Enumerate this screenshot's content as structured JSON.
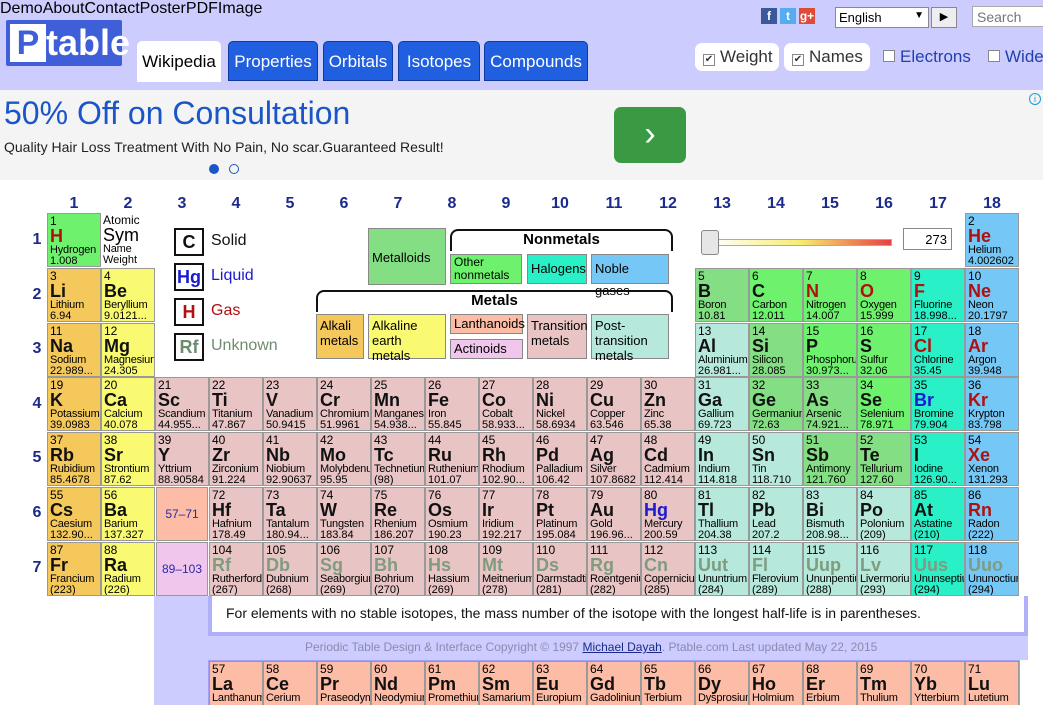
{
  "logo": {
    "text": "Ptable"
  },
  "toplinks": [
    "Demo",
    "About",
    "Contact",
    "Poster",
    "PDF",
    "Image"
  ],
  "social": [
    {
      "icon": "facebook-icon",
      "glyph": "f",
      "color": "#3b5998"
    },
    {
      "icon": "twitter-icon",
      "glyph": "t",
      "color": "#55acee"
    },
    {
      "icon": "google-plus-icon",
      "glyph": "g+",
      "color": "#dd4b39"
    }
  ],
  "language": {
    "selected": "English",
    "go": "▶"
  },
  "search": {
    "placeholder": "Search"
  },
  "tabs": [
    "Wikipedia",
    "Properties",
    "Orbitals",
    "Isotopes",
    "Compounds"
  ],
  "options": [
    {
      "label": "Weight",
      "checked": true
    },
    {
      "label": "Names",
      "checked": true
    },
    {
      "label": "Electrons",
      "checked": false
    },
    {
      "label": "Wide",
      "checked": false
    }
  ],
  "ad": {
    "title": "50% Off on Consultation",
    "subtitle": "Quality Hair Loss Treatment With No Pain, No scar.Guaranteed Result!",
    "button": "›",
    "info": "i"
  },
  "groups": [
    "1",
    "2",
    "3",
    "4",
    "5",
    "6",
    "7",
    "8",
    "9",
    "10",
    "11",
    "12",
    "13",
    "14",
    "15",
    "16",
    "17",
    "18"
  ],
  "periods": [
    "1",
    "2",
    "3",
    "4",
    "5",
    "6",
    "7"
  ],
  "key": {
    "number": "Atomic",
    "symbol": "Sym",
    "name": "Name",
    "weight": "Weight"
  },
  "states": [
    {
      "sym": "C",
      "label": "Solid",
      "color": "#111"
    },
    {
      "sym": "Hg",
      "label": "Liquid",
      "color": "#1a1ad0"
    },
    {
      "sym": "H",
      "label": "Gas",
      "color": "#b01010"
    },
    {
      "sym": "Rf",
      "label": "Unknown",
      "color": "#6f8c6f"
    }
  ],
  "categories": {
    "metalloids": "Metalloids",
    "nonmetals": "Nonmetals",
    "other_nonmetals": "Other nonmetals",
    "halogens": "Halogens",
    "noble": "Noble gases",
    "metals": "Metals",
    "alkali": "Alkali metals",
    "alkaline": "Alkaline earth metals",
    "lanthanoids": "Lanthanoids",
    "actinoids": "Actinoids",
    "transition": "Transition metals",
    "post": "Post-transition metals"
  },
  "temperature": "273",
  "ranges": {
    "lan": "57–71",
    "act": "89–103"
  },
  "note": "For elements with no stable isotopes, the mass number of the isotope with the longest half-life is in parentheses.",
  "copyright": {
    "pre": "Periodic Table Design & Interface Copyright © 1997 ",
    "author": "Michael Dayah",
    "post": ". Ptable.com Last updated May 22, 2015"
  },
  "elements": [
    [
      "1",
      "H",
      "Hydrogen",
      "1.008",
      1,
      1,
      "nm2",
      "g"
    ],
    [
      "2",
      "He",
      "Helium",
      "4.002602",
      18,
      1,
      "ng",
      "g"
    ],
    [
      "3",
      "Li",
      "Lithium",
      "6.94",
      1,
      2,
      "al",
      "s"
    ],
    [
      "4",
      "Be",
      "Beryllium",
      "9.0121...",
      2,
      2,
      "ae",
      "s"
    ],
    [
      "5",
      "B",
      "Boron",
      "10.81",
      13,
      2,
      "mt",
      "s"
    ],
    [
      "6",
      "C",
      "Carbon",
      "12.011",
      14,
      2,
      "nm2",
      "s"
    ],
    [
      "7",
      "N",
      "Nitrogen",
      "14.007",
      15,
      2,
      "nm2",
      "g"
    ],
    [
      "8",
      "O",
      "Oxygen",
      "15.999",
      16,
      2,
      "nm2",
      "g"
    ],
    [
      "9",
      "F",
      "Fluorine",
      "18.998...",
      17,
      2,
      "hl",
      "g"
    ],
    [
      "10",
      "Ne",
      "Neon",
      "20.1797",
      18,
      2,
      "ng",
      "g"
    ],
    [
      "11",
      "Na",
      "Sodium",
      "22.989...",
      1,
      3,
      "al",
      "s"
    ],
    [
      "12",
      "Mg",
      "Magnesium",
      "24.305",
      2,
      3,
      "ae",
      "s"
    ],
    [
      "13",
      "Al",
      "Aluminium",
      "26.981...",
      13,
      3,
      "pt",
      "s"
    ],
    [
      "14",
      "Si",
      "Silicon",
      "28.085",
      14,
      3,
      "mt",
      "s"
    ],
    [
      "15",
      "P",
      "Phosphorus",
      "30.973...",
      15,
      3,
      "nm2",
      "s"
    ],
    [
      "16",
      "S",
      "Sulfur",
      "32.06",
      16,
      3,
      "nm2",
      "s"
    ],
    [
      "17",
      "Cl",
      "Chlorine",
      "35.45",
      17,
      3,
      "hl",
      "g"
    ],
    [
      "18",
      "Ar",
      "Argon",
      "39.948",
      18,
      3,
      "ng",
      "g"
    ],
    [
      "19",
      "K",
      "Potassium",
      "39.0983",
      1,
      4,
      "al",
      "s"
    ],
    [
      "20",
      "Ca",
      "Calcium",
      "40.078",
      2,
      4,
      "ae",
      "s"
    ],
    [
      "21",
      "Sc",
      "Scandium",
      "44.955...",
      3,
      4,
      "tm",
      "s"
    ],
    [
      "22",
      "Ti",
      "Titanium",
      "47.867",
      4,
      4,
      "tm",
      "s"
    ],
    [
      "23",
      "V",
      "Vanadium",
      "50.9415",
      5,
      4,
      "tm",
      "s"
    ],
    [
      "24",
      "Cr",
      "Chromium",
      "51.9961",
      6,
      4,
      "tm",
      "s"
    ],
    [
      "25",
      "Mn",
      "Manganese",
      "54.938...",
      7,
      4,
      "tm",
      "s"
    ],
    [
      "26",
      "Fe",
      "Iron",
      "55.845",
      8,
      4,
      "tm",
      "s"
    ],
    [
      "27",
      "Co",
      "Cobalt",
      "58.933...",
      9,
      4,
      "tm",
      "s"
    ],
    [
      "28",
      "Ni",
      "Nickel",
      "58.6934",
      10,
      4,
      "tm",
      "s"
    ],
    [
      "29",
      "Cu",
      "Copper",
      "63.546",
      11,
      4,
      "tm",
      "s"
    ],
    [
      "30",
      "Zn",
      "Zinc",
      "65.38",
      12,
      4,
      "tm",
      "s"
    ],
    [
      "31",
      "Ga",
      "Gallium",
      "69.723",
      13,
      4,
      "pt",
      "s"
    ],
    [
      "32",
      "Ge",
      "Germanium",
      "72.63",
      14,
      4,
      "mt",
      "s"
    ],
    [
      "33",
      "As",
      "Arsenic",
      "74.921...",
      15,
      4,
      "mt",
      "s"
    ],
    [
      "34",
      "Se",
      "Selenium",
      "78.971",
      16,
      4,
      "nm2",
      "s"
    ],
    [
      "35",
      "Br",
      "Bromine",
      "79.904",
      17,
      4,
      "hl",
      "l"
    ],
    [
      "36",
      "Kr",
      "Krypton",
      "83.798",
      18,
      4,
      "ng",
      "g"
    ],
    [
      "37",
      "Rb",
      "Rubidium",
      "85.4678",
      1,
      5,
      "al",
      "s"
    ],
    [
      "38",
      "Sr",
      "Strontium",
      "87.62",
      2,
      5,
      "ae",
      "s"
    ],
    [
      "39",
      "Y",
      "Yttrium",
      "88.90584",
      3,
      5,
      "tm",
      "s"
    ],
    [
      "40",
      "Zr",
      "Zirconium",
      "91.224",
      4,
      5,
      "tm",
      "s"
    ],
    [
      "41",
      "Nb",
      "Niobium",
      "92.90637",
      5,
      5,
      "tm",
      "s"
    ],
    [
      "42",
      "Mo",
      "Molybdenum",
      "95.95",
      6,
      5,
      "tm",
      "s"
    ],
    [
      "43",
      "Tc",
      "Technetium",
      "(98)",
      7,
      5,
      "tm",
      "s"
    ],
    [
      "44",
      "Ru",
      "Ruthenium",
      "101.07",
      8,
      5,
      "tm",
      "s"
    ],
    [
      "45",
      "Rh",
      "Rhodium",
      "102.90...",
      9,
      5,
      "tm",
      "s"
    ],
    [
      "46",
      "Pd",
      "Palladium",
      "106.42",
      10,
      5,
      "tm",
      "s"
    ],
    [
      "47",
      "Ag",
      "Silver",
      "107.8682",
      11,
      5,
      "tm",
      "s"
    ],
    [
      "48",
      "Cd",
      "Cadmium",
      "112.414",
      12,
      5,
      "tm",
      "s"
    ],
    [
      "49",
      "In",
      "Indium",
      "114.818",
      13,
      5,
      "pt",
      "s"
    ],
    [
      "50",
      "Sn",
      "Tin",
      "118.710",
      14,
      5,
      "pt",
      "s"
    ],
    [
      "51",
      "Sb",
      "Antimony",
      "121.760",
      15,
      5,
      "mt",
      "s"
    ],
    [
      "52",
      "Te",
      "Tellurium",
      "127.60",
      16,
      5,
      "mt",
      "s"
    ],
    [
      "53",
      "I",
      "Iodine",
      "126.90...",
      17,
      5,
      "hl",
      "s"
    ],
    [
      "54",
      "Xe",
      "Xenon",
      "131.293",
      18,
      5,
      "ng",
      "g"
    ],
    [
      "55",
      "Cs",
      "Caesium",
      "132.90...",
      1,
      6,
      "al",
      "s"
    ],
    [
      "56",
      "Ba",
      "Barium",
      "137.327",
      2,
      6,
      "ae",
      "s"
    ],
    [
      "72",
      "Hf",
      "Hafnium",
      "178.49",
      4,
      6,
      "tm",
      "s"
    ],
    [
      "73",
      "Ta",
      "Tantalum",
      "180.94...",
      5,
      6,
      "tm",
      "s"
    ],
    [
      "74",
      "W",
      "Tungsten",
      "183.84",
      6,
      6,
      "tm",
      "s"
    ],
    [
      "75",
      "Re",
      "Rhenium",
      "186.207",
      7,
      6,
      "tm",
      "s"
    ],
    [
      "76",
      "Os",
      "Osmium",
      "190.23",
      8,
      6,
      "tm",
      "s"
    ],
    [
      "77",
      "Ir",
      "Iridium",
      "192.217",
      9,
      6,
      "tm",
      "s"
    ],
    [
      "78",
      "Pt",
      "Platinum",
      "195.084",
      10,
      6,
      "tm",
      "s"
    ],
    [
      "79",
      "Au",
      "Gold",
      "196.96...",
      11,
      6,
      "tm",
      "s"
    ],
    [
      "80",
      "Hg",
      "Mercury",
      "200.59",
      12,
      6,
      "tm",
      "l"
    ],
    [
      "81",
      "Tl",
      "Thallium",
      "204.38",
      13,
      6,
      "pt",
      "s"
    ],
    [
      "82",
      "Pb",
      "Lead",
      "207.2",
      14,
      6,
      "pt",
      "s"
    ],
    [
      "83",
      "Bi",
      "Bismuth",
      "208.98...",
      15,
      6,
      "pt",
      "s"
    ],
    [
      "84",
      "Po",
      "Polonium",
      "(209)",
      16,
      6,
      "pt",
      "s"
    ],
    [
      "85",
      "At",
      "Astatine",
      "(210)",
      17,
      6,
      "hl",
      "s"
    ],
    [
      "86",
      "Rn",
      "Radon",
      "(222)",
      18,
      6,
      "ng",
      "g"
    ],
    [
      "87",
      "Fr",
      "Francium",
      "(223)",
      1,
      7,
      "al",
      "s"
    ],
    [
      "88",
      "Ra",
      "Radium",
      "(226)",
      2,
      7,
      "ae",
      "s"
    ],
    [
      "104",
      "Rf",
      "Rutherfordium",
      "(267)",
      4,
      7,
      "tm",
      "u"
    ],
    [
      "105",
      "Db",
      "Dubnium",
      "(268)",
      5,
      7,
      "tm",
      "u"
    ],
    [
      "106",
      "Sg",
      "Seaborgium",
      "(269)",
      6,
      7,
      "tm",
      "u"
    ],
    [
      "107",
      "Bh",
      "Bohrium",
      "(270)",
      7,
      7,
      "tm",
      "u"
    ],
    [
      "108",
      "Hs",
      "Hassium",
      "(269)",
      8,
      7,
      "tm",
      "u"
    ],
    [
      "109",
      "Mt",
      "Meitnerium",
      "(278)",
      9,
      7,
      "tm",
      "u"
    ],
    [
      "110",
      "Ds",
      "Darmstadtium",
      "(281)",
      10,
      7,
      "tm",
      "u"
    ],
    [
      "111",
      "Rg",
      "Roentgenium",
      "(282)",
      11,
      7,
      "tm",
      "u"
    ],
    [
      "112",
      "Cn",
      "Copernicium",
      "(285)",
      12,
      7,
      "tm",
      "u"
    ],
    [
      "113",
      "Uut",
      "Ununtrium",
      "(284)",
      13,
      7,
      "pt",
      "u"
    ],
    [
      "114",
      "Fl",
      "Flerovium",
      "(289)",
      14,
      7,
      "pt",
      "u"
    ],
    [
      "115",
      "Uup",
      "Ununpentium",
      "(288)",
      15,
      7,
      "pt",
      "u"
    ],
    [
      "116",
      "Lv",
      "Livermorium",
      "(293)",
      16,
      7,
      "pt",
      "u"
    ],
    [
      "117",
      "Uus",
      "Ununseptium",
      "(294)",
      17,
      7,
      "hl",
      "u"
    ],
    [
      "118",
      "Uuo",
      "Ununoctium",
      "(294)",
      18,
      7,
      "ng",
      "u"
    ],
    [
      "57",
      "La",
      "Lanthanum",
      "",
      4,
      9,
      "la",
      "s"
    ],
    [
      "58",
      "Ce",
      "Cerium",
      "",
      5,
      9,
      "la",
      "s"
    ],
    [
      "59",
      "Pr",
      "Praseodymium",
      "",
      6,
      9,
      "la",
      "s"
    ],
    [
      "60",
      "Nd",
      "Neodymium",
      "",
      7,
      9,
      "la",
      "s"
    ],
    [
      "61",
      "Pm",
      "Promethium",
      "",
      8,
      9,
      "la",
      "s"
    ],
    [
      "62",
      "Sm",
      "Samarium",
      "",
      9,
      9,
      "la",
      "s"
    ],
    [
      "63",
      "Eu",
      "Europium",
      "",
      10,
      9,
      "la",
      "s"
    ],
    [
      "64",
      "Gd",
      "Gadolinium",
      "",
      11,
      9,
      "la",
      "s"
    ],
    [
      "65",
      "Tb",
      "Terbium",
      "",
      12,
      9,
      "la",
      "s"
    ],
    [
      "66",
      "Dy",
      "Dysprosium",
      "",
      13,
      9,
      "la",
      "s"
    ],
    [
      "67",
      "Ho",
      "Holmium",
      "",
      14,
      9,
      "la",
      "s"
    ],
    [
      "68",
      "Er",
      "Erbium",
      "",
      15,
      9,
      "la",
      "s"
    ],
    [
      "69",
      "Tm",
      "Thulium",
      "",
      16,
      9,
      "la",
      "s"
    ],
    [
      "70",
      "Yb",
      "Ytterbium",
      "",
      17,
      9,
      "la",
      "s"
    ],
    [
      "71",
      "Lu",
      "Lutetium",
      "",
      18,
      9,
      "la",
      "s"
    ]
  ]
}
